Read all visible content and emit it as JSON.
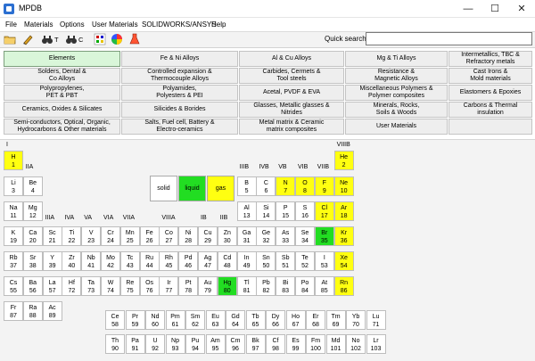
{
  "window": {
    "title": "MPDB",
    "controls": {
      "minimize": "—",
      "maximize": "☐",
      "close": "✕"
    }
  },
  "menu": [
    "File",
    "Materials",
    "Options",
    "User Materials",
    "SOLIDWORKS/ANSYS",
    "Help"
  ],
  "toolbar": {
    "icons": [
      "open-folder-icon",
      "edit-pen-icon",
      "binoculars-icon",
      "binoculars-icon",
      "chart-icon",
      "color-wheel-icon",
      "flask-icon"
    ],
    "binoculars_t_label": "T",
    "binoculars_c_label": "C",
    "search_label": "Quick search",
    "search_value": ""
  },
  "categories": {
    "active": "Elements",
    "items": [
      [
        "Elements",
        "Fe & Ni Alloys",
        "Al & Cu Alloys",
        "Mg & Ti Alloys",
        "Intermetallics, TBC &\nRefractory metals"
      ],
      [
        "Solders, Dental &\nCo Alloys",
        "Controlled expansion &\nThermocouple Alloys",
        "Carbides, Cermets &\nTool steels",
        "Resistance &\nMagnetic Alloys",
        "Cast Irons &\nMold materials"
      ],
      [
        "Polypropylenes,\nPET & PBT",
        "Polyamides,\nPolyesters & PEI",
        "Acetal, PVDF & EVA",
        "Miscellaneous Polymers &\nPolymer composites",
        "Elastomers & Epoxies"
      ],
      [
        "Ceramics, Oxides & Silicates",
        "Silicides & Borides",
        "Glasses, Metallic glasses &\nNitrides",
        "Minerals, Rocks,\nSoils & Woods",
        "Carbons & Thermal\ninsulation"
      ],
      [
        "Semi-conductors, Optical, Organic,\nHydrocarbons & Other materials",
        "Salts, Fuel cell, Battery &\nElectro-ceramics",
        "Metal matrix & Ceramic\nmatrix composites",
        "User Materials",
        ""
      ]
    ]
  },
  "legend": [
    {
      "label": "solid",
      "color": "#ffffff"
    },
    {
      "label": "liquid",
      "color": "#22dd22"
    },
    {
      "label": "gas",
      "color": "#ffff11"
    }
  ],
  "groups": [
    {
      "label": "I",
      "col": 1,
      "row": 0
    },
    {
      "label": "IIA",
      "col": 2,
      "row": 1
    },
    {
      "label": "IIIB",
      "col": 13,
      "row": 1
    },
    {
      "label": "IVB",
      "col": 14,
      "row": 1
    },
    {
      "label": "VB",
      "col": 15,
      "row": 1
    },
    {
      "label": "VIB",
      "col": 16,
      "row": 1
    },
    {
      "label": "VIIB",
      "col": 17,
      "row": 1
    },
    {
      "label": "VIIIB",
      "col": 18,
      "row": 0
    },
    {
      "label": "IIIA",
      "col": 3,
      "row": 3
    },
    {
      "label": "IVA",
      "col": 4,
      "row": 3
    },
    {
      "label": "VA",
      "col": 5,
      "row": 3
    },
    {
      "label": "VIA",
      "col": 6,
      "row": 3
    },
    {
      "label": "VIIA",
      "col": 7,
      "row": 3
    },
    {
      "label": "VIIIA",
      "col": 9,
      "row": 3
    },
    {
      "label": "IB",
      "col": 11,
      "row": 3
    },
    {
      "label": "IIB",
      "col": 12,
      "row": 3
    }
  ],
  "elements": [
    [
      "H",
      1,
      1,
      1,
      "gas"
    ],
    [
      "He",
      2,
      18,
      1,
      "gas"
    ],
    [
      "Li",
      3,
      1,
      2,
      "solid"
    ],
    [
      "Be",
      4,
      2,
      2,
      "solid"
    ],
    [
      "B",
      5,
      13,
      2,
      "solid"
    ],
    [
      "C",
      6,
      14,
      2,
      "solid"
    ],
    [
      "N",
      7,
      15,
      2,
      "gas"
    ],
    [
      "O",
      8,
      16,
      2,
      "gas"
    ],
    [
      "F",
      9,
      17,
      2,
      "gas"
    ],
    [
      "Ne",
      10,
      18,
      2,
      "gas"
    ],
    [
      "Na",
      11,
      1,
      3,
      "solid"
    ],
    [
      "Mg",
      12,
      2,
      3,
      "solid"
    ],
    [
      "Al",
      13,
      13,
      3,
      "solid"
    ],
    [
      "Si",
      14,
      14,
      3,
      "solid"
    ],
    [
      "P",
      15,
      15,
      3,
      "solid"
    ],
    [
      "S",
      16,
      16,
      3,
      "solid"
    ],
    [
      "Cl",
      17,
      17,
      3,
      "gas"
    ],
    [
      "Ar",
      18,
      18,
      3,
      "gas"
    ],
    [
      "K",
      19,
      1,
      4,
      "solid"
    ],
    [
      "Ca",
      20,
      2,
      4,
      "solid"
    ],
    [
      "Sc",
      21,
      3,
      4,
      "solid"
    ],
    [
      "Ti",
      22,
      4,
      4,
      "solid"
    ],
    [
      "V",
      23,
      5,
      4,
      "solid"
    ],
    [
      "Cr",
      24,
      6,
      4,
      "solid"
    ],
    [
      "Mn",
      25,
      7,
      4,
      "solid"
    ],
    [
      "Fe",
      26,
      8,
      4,
      "solid"
    ],
    [
      "Co",
      27,
      9,
      4,
      "solid"
    ],
    [
      "Ni",
      28,
      10,
      4,
      "solid"
    ],
    [
      "Cu",
      29,
      11,
      4,
      "solid"
    ],
    [
      "Zn",
      30,
      12,
      4,
      "solid"
    ],
    [
      "Ga",
      31,
      13,
      4,
      "solid"
    ],
    [
      "Ge",
      32,
      14,
      4,
      "solid"
    ],
    [
      "As",
      33,
      15,
      4,
      "solid"
    ],
    [
      "Se",
      34,
      16,
      4,
      "solid"
    ],
    [
      "Br",
      35,
      17,
      4,
      "liquid"
    ],
    [
      "Kr",
      36,
      18,
      4,
      "gas"
    ],
    [
      "Rb",
      37,
      1,
      5,
      "solid"
    ],
    [
      "Sr",
      38,
      2,
      5,
      "solid"
    ],
    [
      "Y",
      39,
      3,
      5,
      "solid"
    ],
    [
      "Zr",
      40,
      4,
      5,
      "solid"
    ],
    [
      "Nb",
      41,
      5,
      5,
      "solid"
    ],
    [
      "Mo",
      42,
      6,
      5,
      "solid"
    ],
    [
      "Tc",
      43,
      7,
      5,
      "solid"
    ],
    [
      "Ru",
      44,
      8,
      5,
      "solid"
    ],
    [
      "Rh",
      45,
      9,
      5,
      "solid"
    ],
    [
      "Pd",
      46,
      10,
      5,
      "solid"
    ],
    [
      "Ag",
      47,
      11,
      5,
      "solid"
    ],
    [
      "Cd",
      48,
      12,
      5,
      "solid"
    ],
    [
      "In",
      49,
      13,
      5,
      "solid"
    ],
    [
      "Sn",
      50,
      14,
      5,
      "solid"
    ],
    [
      "Sb",
      51,
      15,
      5,
      "solid"
    ],
    [
      "Te",
      52,
      16,
      5,
      "solid"
    ],
    [
      "I",
      53,
      17,
      5,
      "solid"
    ],
    [
      "Xe",
      54,
      18,
      5,
      "gas"
    ],
    [
      "Cs",
      55,
      1,
      6,
      "solid"
    ],
    [
      "Ba",
      56,
      2,
      6,
      "solid"
    ],
    [
      "La",
      57,
      3,
      6,
      "solid"
    ],
    [
      "Hf",
      72,
      4,
      6,
      "solid"
    ],
    [
      "Ta",
      73,
      5,
      6,
      "solid"
    ],
    [
      "W",
      74,
      6,
      6,
      "solid"
    ],
    [
      "Re",
      75,
      7,
      6,
      "solid"
    ],
    [
      "Os",
      76,
      8,
      6,
      "solid"
    ],
    [
      "Ir",
      77,
      9,
      6,
      "solid"
    ],
    [
      "Pt",
      78,
      10,
      6,
      "solid"
    ],
    [
      "Au",
      79,
      11,
      6,
      "solid"
    ],
    [
      "Hg",
      80,
      12,
      6,
      "liquid"
    ],
    [
      "Tl",
      81,
      13,
      6,
      "solid"
    ],
    [
      "Pb",
      82,
      14,
      6,
      "solid"
    ],
    [
      "Bi",
      83,
      15,
      6,
      "solid"
    ],
    [
      "Po",
      84,
      16,
      6,
      "solid"
    ],
    [
      "At",
      85,
      17,
      6,
      "solid"
    ],
    [
      "Rn",
      86,
      18,
      6,
      "gas"
    ],
    [
      "Fr",
      87,
      1,
      7,
      "solid"
    ],
    [
      "Ra",
      88,
      2,
      7,
      "solid"
    ],
    [
      "Ac",
      89,
      3,
      7,
      "solid"
    ]
  ],
  "lanthanides": [
    [
      "Ce",
      58
    ],
    [
      "Pr",
      59
    ],
    [
      "Nd",
      60
    ],
    [
      "Pm",
      61
    ],
    [
      "Sm",
      62
    ],
    [
      "Eu",
      63
    ],
    [
      "Gd",
      64
    ],
    [
      "Tb",
      65
    ],
    [
      "Dy",
      66
    ],
    [
      "Ho",
      67
    ],
    [
      "Er",
      68
    ],
    [
      "Tm",
      69
    ],
    [
      "Yb",
      70
    ],
    [
      "Lu",
      71
    ]
  ],
  "actinides": [
    [
      "Th",
      90
    ],
    [
      "Pa",
      91
    ],
    [
      "U",
      92
    ],
    [
      "Np",
      93
    ],
    [
      "Pu",
      94
    ],
    [
      "Am",
      95
    ],
    [
      "Cm",
      96
    ],
    [
      "Bk",
      97
    ],
    [
      "Cf",
      98
    ],
    [
      "Es",
      99
    ],
    [
      "Fm",
      100
    ],
    [
      "Md",
      101
    ],
    [
      "No",
      102
    ],
    [
      "Lr",
      103
    ]
  ]
}
